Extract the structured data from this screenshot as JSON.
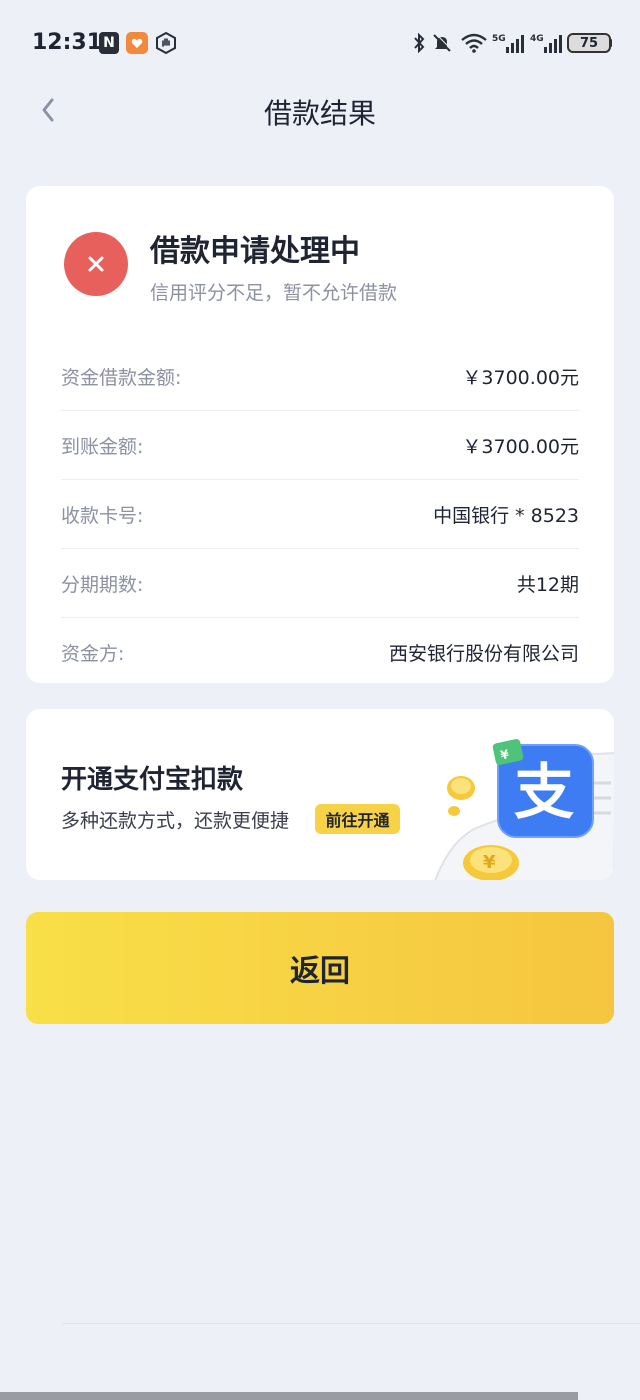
{
  "status_bar": {
    "time": "12:31",
    "nfc_glyph": "N",
    "battery": "75",
    "icons": [
      "nfc-icon",
      "shield-heart-icon",
      "hand-icon",
      "bluetooth-icon",
      "bell-muted-icon",
      "wifi-icon",
      "signal-5g-icon",
      "signal-4g-icon",
      "battery-icon"
    ]
  },
  "header": {
    "title": "借款结果",
    "back_icon": "chevron-left-icon"
  },
  "result": {
    "title": "借款申请处理中",
    "subtitle": "信用评分不足，暂不允许借款",
    "icon": "close-icon",
    "icon_color": "#e8605c",
    "details": [
      {
        "label": "资金借款金额:",
        "value": "￥3700.00元"
      },
      {
        "label": "到账金额:",
        "value": "￥3700.00元"
      },
      {
        "label": "收款卡号:",
        "value": "中国银行 * 8523"
      },
      {
        "label": "分期期数:",
        "value": "共12期"
      },
      {
        "label": "资金方:",
        "value": "西安银行股份有限公司"
      }
    ]
  },
  "promo": {
    "title": "开通支付宝扣款",
    "description": "多种还款方式，还款更便捷",
    "button_label": "前往开通",
    "art_glyph": "支",
    "brand_color": "#3d7cf3"
  },
  "return_button": {
    "label": "返回",
    "colors": [
      "#f9df48",
      "#f5c53f"
    ]
  }
}
